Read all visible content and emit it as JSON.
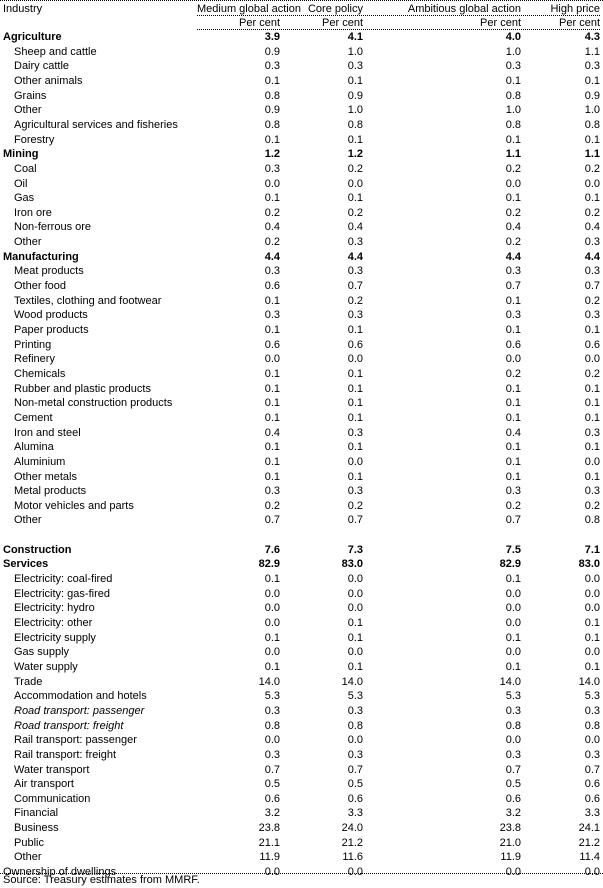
{
  "header": {
    "industry_label": "Industry",
    "columns": [
      "Medium global action",
      "Core policy",
      "Ambitious global action",
      "High price"
    ],
    "units": [
      "Per cent",
      "Per cent",
      "Per cent",
      "Per cent"
    ]
  },
  "rows": [
    {
      "label": "Agriculture",
      "type": "section",
      "values": [
        "3.9",
        "4.1",
        "4.0",
        "4.3"
      ]
    },
    {
      "label": "Sheep and cattle",
      "type": "sub",
      "values": [
        "0.9",
        "1.0",
        "1.0",
        "1.1"
      ]
    },
    {
      "label": "Dairy cattle",
      "type": "sub",
      "values": [
        "0.3",
        "0.3",
        "0.3",
        "0.3"
      ]
    },
    {
      "label": "Other animals",
      "type": "sub",
      "values": [
        "0.1",
        "0.1",
        "0.1",
        "0.1"
      ]
    },
    {
      "label": "Grains",
      "type": "sub",
      "values": [
        "0.8",
        "0.9",
        "0.8",
        "0.9"
      ]
    },
    {
      "label": "Other",
      "type": "sub",
      "values": [
        "0.9",
        "1.0",
        "1.0",
        "1.0"
      ]
    },
    {
      "label": "Agricultural services and fisheries",
      "type": "sub",
      "values": [
        "0.8",
        "0.8",
        "0.8",
        "0.8"
      ]
    },
    {
      "label": "Forestry",
      "type": "sub",
      "values": [
        "0.1",
        "0.1",
        "0.1",
        "0.1"
      ]
    },
    {
      "label": "Mining",
      "type": "section",
      "values": [
        "1.2",
        "1.2",
        "1.1",
        "1.1"
      ]
    },
    {
      "label": "Coal",
      "type": "sub",
      "values": [
        "0.3",
        "0.2",
        "0.2",
        "0.2"
      ]
    },
    {
      "label": "Oil",
      "type": "sub",
      "values": [
        "0.0",
        "0.0",
        "0.0",
        "0.0"
      ]
    },
    {
      "label": "Gas",
      "type": "sub",
      "values": [
        "0.1",
        "0.1",
        "0.1",
        "0.1"
      ]
    },
    {
      "label": "Iron ore",
      "type": "sub",
      "values": [
        "0.2",
        "0.2",
        "0.2",
        "0.2"
      ]
    },
    {
      "label": "Non-ferrous ore",
      "type": "sub",
      "values": [
        "0.4",
        "0.4",
        "0.4",
        "0.4"
      ]
    },
    {
      "label": "Other",
      "type": "sub",
      "values": [
        "0.2",
        "0.3",
        "0.2",
        "0.3"
      ]
    },
    {
      "label": "Manufacturing",
      "type": "section",
      "values": [
        "4.4",
        "4.4",
        "4.4",
        "4.4"
      ]
    },
    {
      "label": "Meat products",
      "type": "sub",
      "values": [
        "0.3",
        "0.3",
        "0.3",
        "0.3"
      ]
    },
    {
      "label": "Other food",
      "type": "sub",
      "values": [
        "0.6",
        "0.7",
        "0.7",
        "0.7"
      ]
    },
    {
      "label": "Textiles, clothing and footwear",
      "type": "sub",
      "values": [
        "0.1",
        "0.2",
        "0.1",
        "0.2"
      ]
    },
    {
      "label": "Wood products",
      "type": "sub",
      "values": [
        "0.3",
        "0.3",
        "0.3",
        "0.3"
      ]
    },
    {
      "label": "Paper products",
      "type": "sub",
      "values": [
        "0.1",
        "0.1",
        "0.1",
        "0.1"
      ]
    },
    {
      "label": "Printing",
      "type": "sub",
      "values": [
        "0.6",
        "0.6",
        "0.6",
        "0.6"
      ]
    },
    {
      "label": "Refinery",
      "type": "sub",
      "values": [
        "0.0",
        "0.0",
        "0.0",
        "0.0"
      ]
    },
    {
      "label": "Chemicals",
      "type": "sub",
      "values": [
        "0.1",
        "0.1",
        "0.2",
        "0.2"
      ]
    },
    {
      "label": "Rubber and plastic products",
      "type": "sub",
      "values": [
        "0.1",
        "0.1",
        "0.1",
        "0.1"
      ]
    },
    {
      "label": "Non-metal construction products",
      "type": "sub",
      "values": [
        "0.1",
        "0.1",
        "0.1",
        "0.1"
      ]
    },
    {
      "label": "Cement",
      "type": "sub",
      "values": [
        "0.1",
        "0.1",
        "0.1",
        "0.1"
      ]
    },
    {
      "label": "Iron and steel",
      "type": "sub",
      "values": [
        "0.4",
        "0.3",
        "0.4",
        "0.3"
      ]
    },
    {
      "label": "Alumina",
      "type": "sub",
      "values": [
        "0.1",
        "0.1",
        "0.1",
        "0.1"
      ]
    },
    {
      "label": "Aluminium",
      "type": "sub",
      "values": [
        "0.1",
        "0.0",
        "0.1",
        "0.0"
      ]
    },
    {
      "label": "Other metals",
      "type": "sub",
      "values": [
        "0.1",
        "0.1",
        "0.1",
        "0.1"
      ]
    },
    {
      "label": "Metal products",
      "type": "sub",
      "values": [
        "0.3",
        "0.3",
        "0.3",
        "0.3"
      ]
    },
    {
      "label": "Motor vehicles and parts",
      "type": "sub",
      "values": [
        "0.2",
        "0.2",
        "0.2",
        "0.2"
      ]
    },
    {
      "label": "Other",
      "type": "sub",
      "values": [
        "0.7",
        "0.7",
        "0.7",
        "0.8"
      ]
    },
    {
      "label": "",
      "type": "blank",
      "values": [
        "",
        "",
        "",
        ""
      ]
    },
    {
      "label": "Construction",
      "type": "section",
      "values": [
        "7.6",
        "7.3",
        "7.5",
        "7.1"
      ]
    },
    {
      "label": "Services",
      "type": "section",
      "values": [
        "82.9",
        "83.0",
        "82.9",
        "83.0"
      ]
    },
    {
      "label": "Electricity: coal-fired",
      "type": "sub",
      "values": [
        "0.1",
        "0.0",
        "0.1",
        "0.0"
      ]
    },
    {
      "label": "Electricity: gas-fired",
      "type": "sub",
      "values": [
        "0.0",
        "0.0",
        "0.0",
        "0.0"
      ]
    },
    {
      "label": "Electricity: hydro",
      "type": "sub",
      "values": [
        "0.0",
        "0.0",
        "0.0",
        "0.0"
      ]
    },
    {
      "label": "Electricity: other",
      "type": "sub",
      "values": [
        "0.0",
        "0.1",
        "0.0",
        "0.1"
      ]
    },
    {
      "label": "Electricity supply",
      "type": "sub",
      "values": [
        "0.1",
        "0.1",
        "0.1",
        "0.1"
      ]
    },
    {
      "label": "Gas supply",
      "type": "sub",
      "values": [
        "0.0",
        "0.0",
        "0.0",
        "0.0"
      ]
    },
    {
      "label": "Water supply",
      "type": "sub",
      "values": [
        "0.1",
        "0.1",
        "0.1",
        "0.1"
      ]
    },
    {
      "label": "Trade",
      "type": "sub",
      "values": [
        "14.0",
        "14.0",
        "14.0",
        "14.0"
      ]
    },
    {
      "label": "Accommodation and hotels",
      "type": "sub",
      "values": [
        "5.3",
        "5.3",
        "5.3",
        "5.3"
      ]
    },
    {
      "label": "Road transport: passenger",
      "type": "sub-italic",
      "values": [
        "0.3",
        "0.3",
        "0.3",
        "0.3"
      ]
    },
    {
      "label": "Road transport: freight",
      "type": "sub-italic",
      "values": [
        "0.8",
        "0.8",
        "0.8",
        "0.8"
      ]
    },
    {
      "label": "Rail transport: passenger",
      "type": "sub",
      "values": [
        "0.0",
        "0.0",
        "0.0",
        "0.0"
      ]
    },
    {
      "label": "Rail transport:  freight",
      "type": "sub",
      "values": [
        "0.3",
        "0.3",
        "0.3",
        "0.3"
      ]
    },
    {
      "label": "Water transport",
      "type": "sub",
      "values": [
        "0.7",
        "0.7",
        "0.7",
        "0.7"
      ]
    },
    {
      "label": "Air transport",
      "type": "sub",
      "values": [
        "0.5",
        "0.5",
        "0.5",
        "0.6"
      ]
    },
    {
      "label": "Communication",
      "type": "sub",
      "values": [
        "0.6",
        "0.6",
        "0.6",
        "0.6"
      ]
    },
    {
      "label": "Financial",
      "type": "sub",
      "values": [
        "3.2",
        "3.3",
        "3.2",
        "3.3"
      ]
    },
    {
      "label": "Business",
      "type": "sub",
      "values": [
        "23.8",
        "24.0",
        "23.8",
        "24.1"
      ]
    },
    {
      "label": "Public",
      "type": "sub",
      "values": [
        "21.1",
        "21.2",
        "21.0",
        "21.2"
      ]
    },
    {
      "label": "Other",
      "type": "sub",
      "values": [
        "11.9",
        "11.6",
        "11.9",
        "11.4"
      ]
    },
    {
      "label": "Ownership of dwellings",
      "type": "plain",
      "values": [
        "0.0",
        "0.0",
        "0.0",
        "0.0"
      ]
    }
  ],
  "source": "Source: Treasury estimates from MMRF."
}
